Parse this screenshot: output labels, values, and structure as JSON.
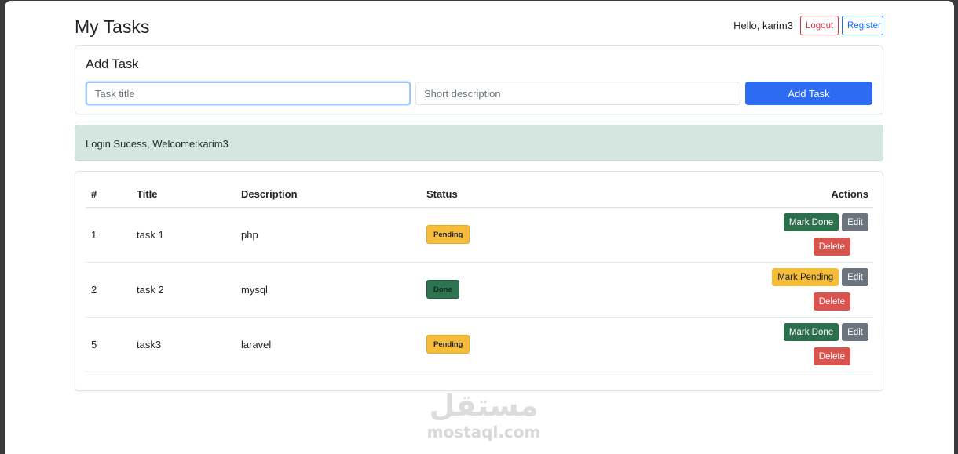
{
  "header": {
    "title": "My Tasks",
    "greeting": "Hello, karim3",
    "logout_label": "Logout",
    "register_label": "Register"
  },
  "add_task": {
    "heading": "Add Task",
    "title_placeholder": "Task title",
    "description_placeholder": "Short description",
    "button_label": "Add Task"
  },
  "alert": {
    "message": "Login Sucess, Welcome:karim3"
  },
  "table": {
    "headers": {
      "num": "#",
      "title": "Title",
      "description": "Description",
      "status": "Status",
      "actions": "Actions"
    },
    "rows": [
      {
        "num": "1",
        "title": "task 1",
        "description": "php",
        "status": "Pending",
        "toggle_label": "Mark Done",
        "edit_label": "Edit",
        "delete_label": "Delete"
      },
      {
        "num": "2",
        "title": "task 2",
        "description": "mysql",
        "status": "Done",
        "toggle_label": "Mark Pending",
        "edit_label": "Edit",
        "delete_label": "Delete"
      },
      {
        "num": "5",
        "title": "task3",
        "description": "laravel",
        "status": "Pending",
        "toggle_label": "Mark Done",
        "edit_label": "Edit",
        "delete_label": "Delete"
      }
    ]
  },
  "watermark": {
    "arabic": "مستقل",
    "latin": "mostaql.com"
  },
  "colors": {
    "primary": "#2d6cf2",
    "success": "#2d6e4c",
    "warning": "#f6bd3a",
    "danger": "#d9534f",
    "secondary": "#6c757d",
    "alert_bg": "#d4e6df"
  }
}
